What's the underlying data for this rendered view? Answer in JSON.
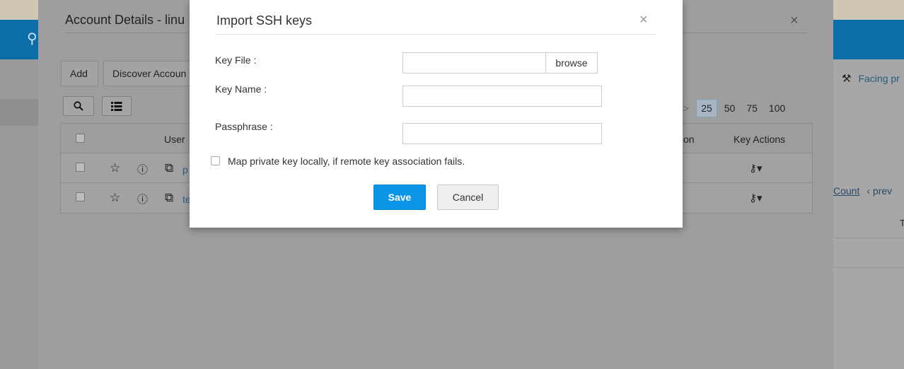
{
  "background": {
    "panel_title": "Account Details - linu",
    "buttons": {
      "add": "Add",
      "discover": "Discover Accoun"
    },
    "pager": {
      "prev_chev": "<",
      "next_chev": ">",
      "sizes": [
        "25",
        "50",
        "75",
        "100"
      ],
      "selected": "25"
    },
    "grid": {
      "col_user": "User",
      "col_partial": "on",
      "col_key_actions": "Key Actions",
      "rows": [
        {
          "name_fragment": "p"
        },
        {
          "name_fragment": "te"
        }
      ]
    },
    "right_panel": {
      "facing_text": "Facing pr",
      "count_link": "Count",
      "prev_text": "prev",
      "col_fragment": "T"
    }
  },
  "modal": {
    "title": "Import SSH keys",
    "close_glyph": "×",
    "fields": {
      "key_file": {
        "label": "Key File :",
        "value": "",
        "browse_label": "browse"
      },
      "key_name": {
        "label": "Key Name :",
        "value": ""
      },
      "passphrase": {
        "label": "Passphrase :",
        "value": ""
      }
    },
    "map_locally": {
      "label": "Map private key locally, if remote key association fails.",
      "checked": false
    },
    "actions": {
      "save": "Save",
      "cancel": "Cancel"
    },
    "colors": {
      "primary": "#0a95e6",
      "overlay_gray": "#9e9e9e"
    }
  }
}
